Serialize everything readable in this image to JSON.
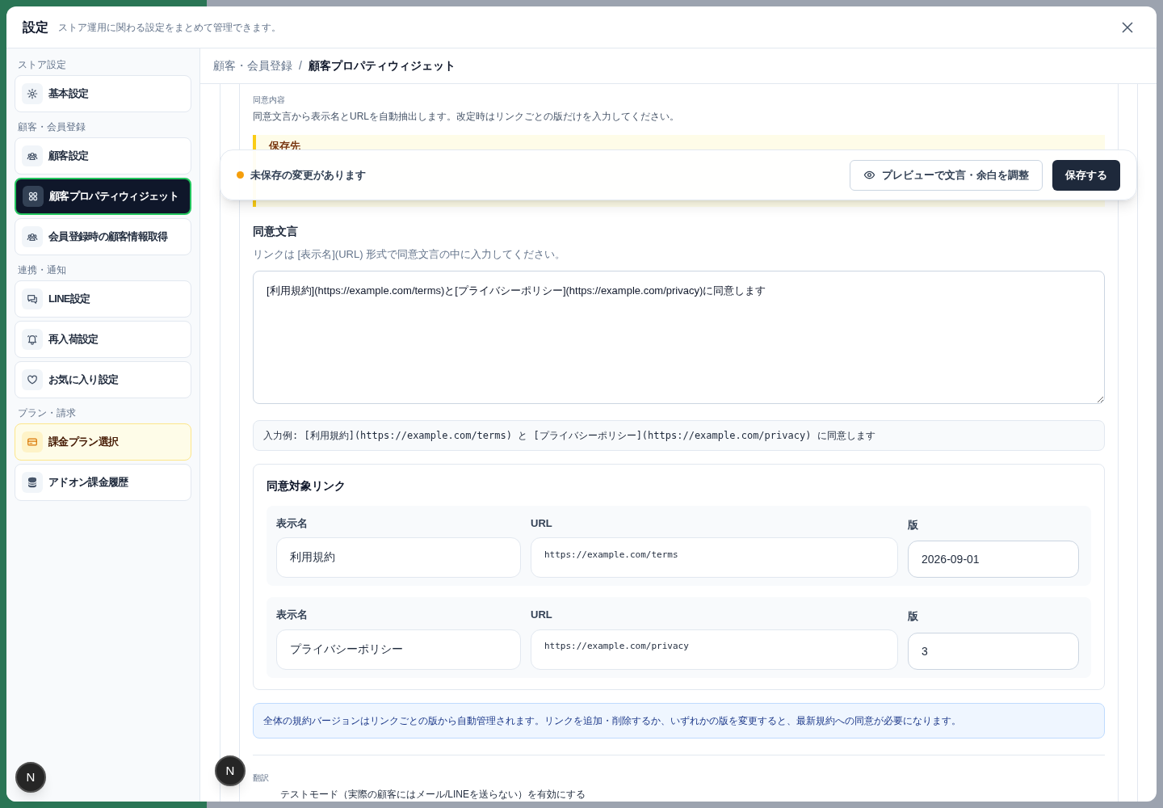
{
  "modal": {
    "title": "設定",
    "subtitle": "ストア運用に関わる設定をまとめて管理できます。"
  },
  "sidebar": {
    "groups": [
      {
        "label": "ストア設定",
        "items": [
          {
            "label": "基本設定",
            "selected": false,
            "kind": "normal"
          }
        ]
      },
      {
        "label": "顧客・会員登録",
        "items": [
          {
            "label": "顧客設定",
            "selected": false,
            "kind": "normal"
          },
          {
            "label": "顧客プロパティウィジェット",
            "selected": true,
            "kind": "normal"
          },
          {
            "label": "会員登録時の顧客情報取得",
            "selected": false,
            "kind": "normal"
          }
        ]
      },
      {
        "label": "連携・通知",
        "items": [
          {
            "label": "LINE設定",
            "selected": false,
            "kind": "normal"
          },
          {
            "label": "再入荷設定",
            "selected": false,
            "kind": "normal"
          },
          {
            "label": "お気に入り設定",
            "selected": false,
            "kind": "normal"
          }
        ]
      },
      {
        "label": "プラン・請求",
        "items": [
          {
            "label": "課金プラン選択",
            "selected": false,
            "kind": "featured"
          },
          {
            "label": "アドオン課金履歴",
            "selected": false,
            "kind": "normal"
          }
        ]
      }
    ]
  },
  "breadcrumb": {
    "items": [
      "顧客・会員登録",
      "顧客プロパティウィジェット"
    ],
    "separator": "/"
  },
  "section": {
    "label": "同意内容",
    "description": "同意文言から表示名とURLを自動抽出します。改定時はリンクごとの版だけを入力してください。"
  },
  "notice": {
    "title": "保存先"
  },
  "unsaved_bar": {
    "status": "未保存の変更があります",
    "preview_button": "プレビューで文言・余白を調整",
    "save_button": "保存する"
  },
  "consent_text": {
    "label": "同意文言",
    "help": "リンクは [表示名](URL) 形式で同意文言の中に入力してください。",
    "value": "[利用規約](https://example.com/terms)と[プライバシーポリシー](https://example.com/privacy)に同意します"
  },
  "example": "入力例: [利用規約](https://example.com/terms) と [プライバシーポリシー](https://example.com/privacy) に同意します",
  "links": {
    "title": "同意対象リンク",
    "rows": [
      {
        "name_label": "表示名",
        "name": "利用規約",
        "url_label": "URL",
        "url": "https://example.com/terms",
        "version_label": "版",
        "version": "2026-09-01"
      },
      {
        "name_label": "表示名",
        "name": "プライバシーポリシー",
        "url_label": "URL",
        "url": "https://example.com/privacy",
        "version_label": "版",
        "version": "3"
      }
    ]
  },
  "info": "全体の規約バージョンはリンクごとの版から自動管理されます。リンクを追加・削除するか、いずれかの版を変更すると、最新規約への同意が必要になります。",
  "translation": {
    "label": "翻訳",
    "option": "テストモード（実際の顧客にはメール/LINEを送らない）を有効にする"
  },
  "dev_buttons": [
    "N",
    "N"
  ]
}
